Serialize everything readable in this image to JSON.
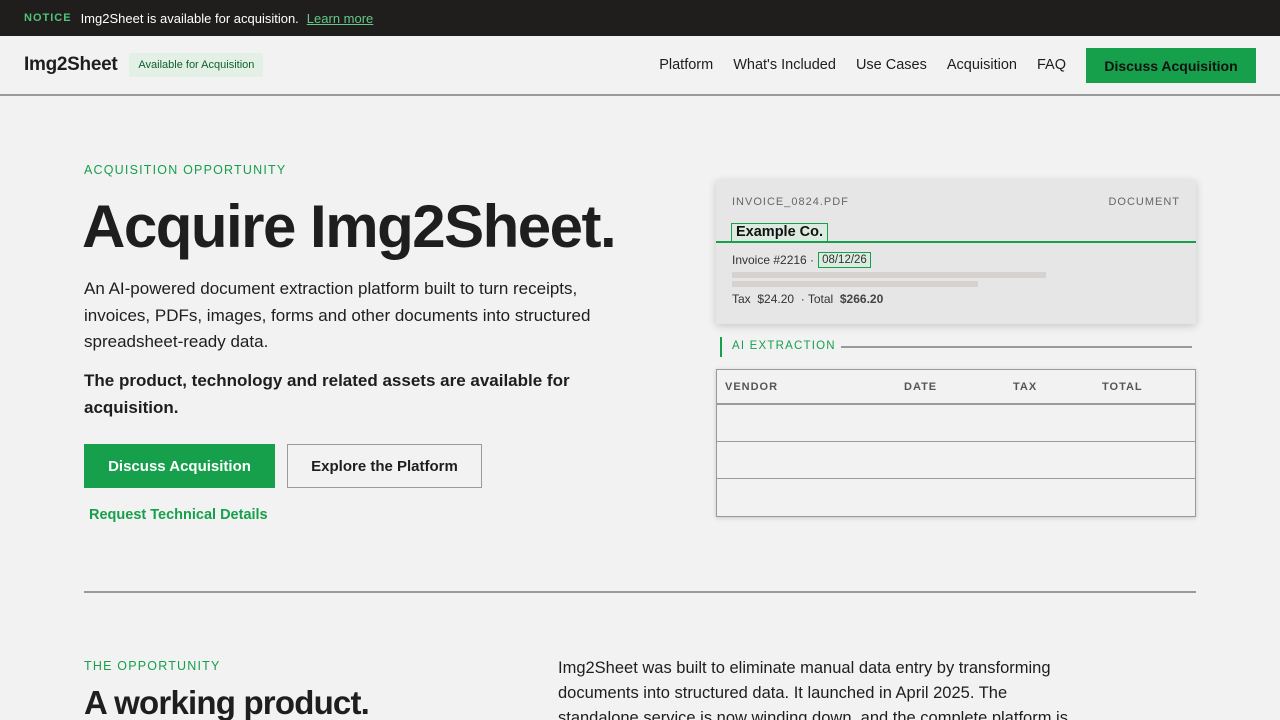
{
  "notice": {
    "tag": "NOTICE",
    "text": "Img2Sheet is available for acquisition.",
    "link": "Learn more"
  },
  "nav": {
    "logo": "Img2Sheet",
    "badge": "Available for Acquisition",
    "links": [
      "Platform",
      "What's Included",
      "Use Cases",
      "Acquisition",
      "FAQ"
    ],
    "cta": "Discuss Acquisition"
  },
  "hero": {
    "eyebrow": "ACQUISITION OPPORTUNITY",
    "title": "Acquire Img2Sheet.",
    "description": "An AI-powered document extraction platform built to turn receipts, invoices, PDFs, images, forms and other documents into structured spreadsheet-ready data.",
    "strong": "The product, technology and related assets are available for acquisition.",
    "primary_button": "Discuss Acquisition",
    "secondary_button": "Explore the Platform",
    "tech_link": "Request Technical Details"
  },
  "document": {
    "filename": "INVOICE_0824.PDF",
    "type": "DOCUMENT",
    "company": "Example Co.",
    "invoice_label": "Invoice #2216 ·",
    "date": "08/12/26",
    "tax_label": "Tax",
    "tax_value": "$24.20",
    "total_label": "· Total",
    "total_value": "$266.20"
  },
  "extraction": {
    "label": "AI EXTRACTION",
    "columns": [
      "VENDOR",
      "DATE",
      "TAX",
      "TOTAL"
    ],
    "rows": [
      [
        "",
        "",
        "",
        ""
      ],
      [
        "",
        "",
        "",
        ""
      ],
      [
        "",
        "",
        "",
        ""
      ]
    ]
  },
  "opportunity": {
    "eyebrow": "THE OPPORTUNITY",
    "title": "A working product.",
    "body": "Img2Sheet was built to eliminate manual data entry by transforming documents into structured data. It launched in April 2025. The standalone service is now winding down, and the complete platform is offered for"
  },
  "colors": {
    "accent": "#16a04b",
    "dark": "#1f1e1d",
    "background": "#f2f2f2"
  }
}
